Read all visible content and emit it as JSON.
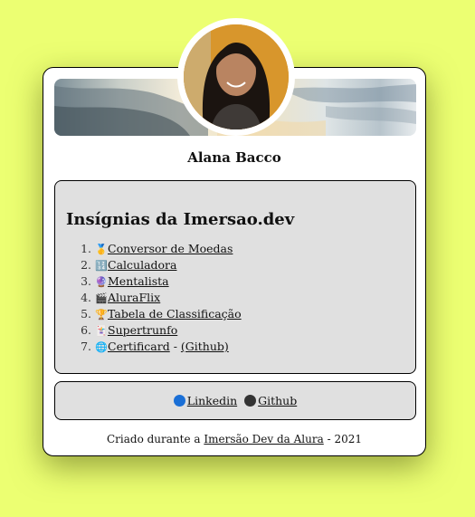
{
  "profile": {
    "name": "Alana Bacco"
  },
  "badges": {
    "title": "Insígnias da Imersao.dev",
    "items": [
      {
        "num": "1.",
        "icon": "🥇",
        "icon_name": "medal-icon",
        "label": "Conversor de Moedas"
      },
      {
        "num": "2.",
        "icon": "🔢",
        "icon_name": "calculator-icon",
        "label": "Calculadora"
      },
      {
        "num": "3.",
        "icon": "🔮",
        "icon_name": "crystal-ball-icon",
        "label": "Mentalista"
      },
      {
        "num": "4.",
        "icon": "🎬",
        "icon_name": "clapperboard-icon",
        "label": "AluraFlix"
      },
      {
        "num": "5.",
        "icon": "🏆",
        "icon_name": "trophy-icon",
        "label": "Tabela de Classificação"
      },
      {
        "num": "6.",
        "icon": "🃏",
        "icon_name": "card-icon",
        "label": "Supertrunfo"
      },
      {
        "num": "7.",
        "icon": "🌐",
        "icon_name": "globe-icon",
        "label": "Certificard",
        "separator": " - ",
        "extra_label": "(Github)"
      }
    ]
  },
  "social": {
    "linkedin_label": "Linkedin",
    "github_label": "Github",
    "linkedin_color": "#1a6fd6",
    "github_color": "#333333"
  },
  "footer": {
    "prefix": "Criado durante a ",
    "link": "Imersão Dev da Alura",
    "suffix": " - 2021"
  },
  "colors": {
    "page_background": "#ecff72",
    "panel_background": "#e0e0e0"
  }
}
